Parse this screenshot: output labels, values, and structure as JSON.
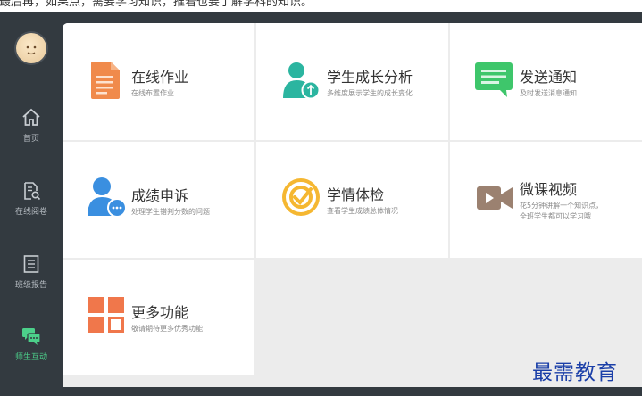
{
  "caption_strip": "最后再，如果点，需要学习知识，推着也要了解学科的知识。",
  "sidebar": {
    "items": [
      {
        "label": "首页"
      },
      {
        "label": "在线阅卷"
      },
      {
        "label": "班级报告"
      },
      {
        "label": "师生互动"
      }
    ]
  },
  "cards": [
    {
      "title": "在线作业",
      "desc": "在线布置作业"
    },
    {
      "title": "学生成长分析",
      "desc": "多维度展示学生的成长变化"
    },
    {
      "title": "发送通知",
      "desc": "及时发送消息通知"
    },
    {
      "title": "成绩申诉",
      "desc": "处理学生错判分数的问题"
    },
    {
      "title": "学情体检",
      "desc": "查看学生成绩总体情况"
    },
    {
      "title": "微课视频",
      "desc_line1": "花5分钟讲解一个知识点，",
      "desc_line2": "全班学生都可以学习哦"
    },
    {
      "title": "更多功能",
      "desc": "敬请期待更多优秀功能"
    }
  ],
  "watermark": "最需教育",
  "colors": {
    "sidebar_bg": "#333a40",
    "active_green": "#4cd08a",
    "orange": "#f08a4b",
    "teal": "#2bb5a0",
    "green": "#3ec66b",
    "blue": "#3a8fe0",
    "yellow": "#f5b731",
    "brown": "#9b8170"
  }
}
